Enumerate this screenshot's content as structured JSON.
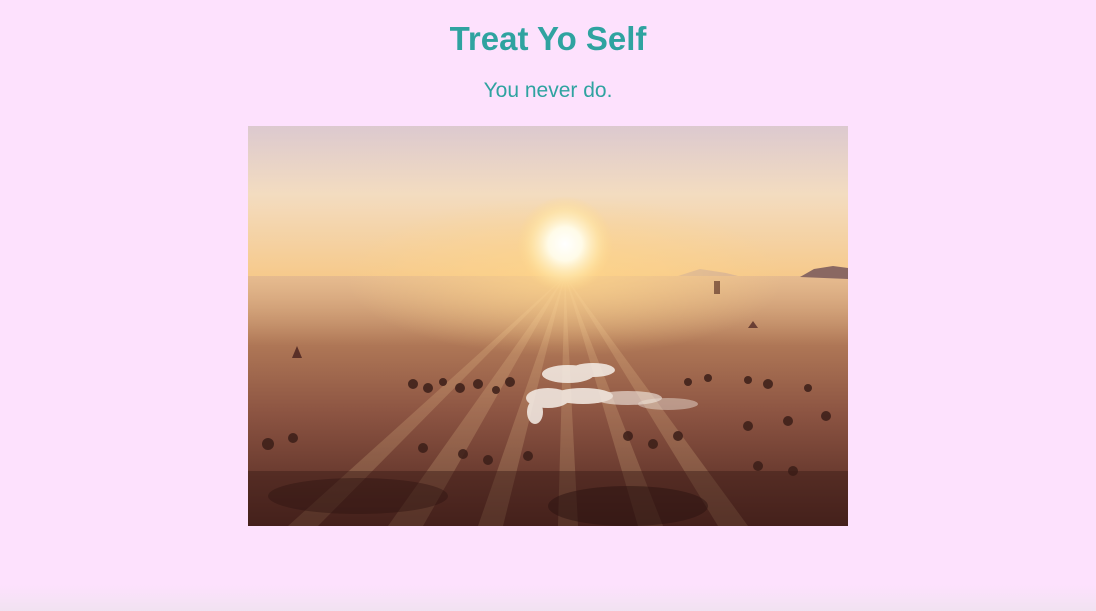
{
  "header": {
    "title": "Treat Yo Self",
    "subtitle": "You never do."
  },
  "photo": {
    "description_icon": "sunrise-landscape-image"
  },
  "colors": {
    "background": "#fde1fd",
    "heading": "#2fa3a0"
  }
}
